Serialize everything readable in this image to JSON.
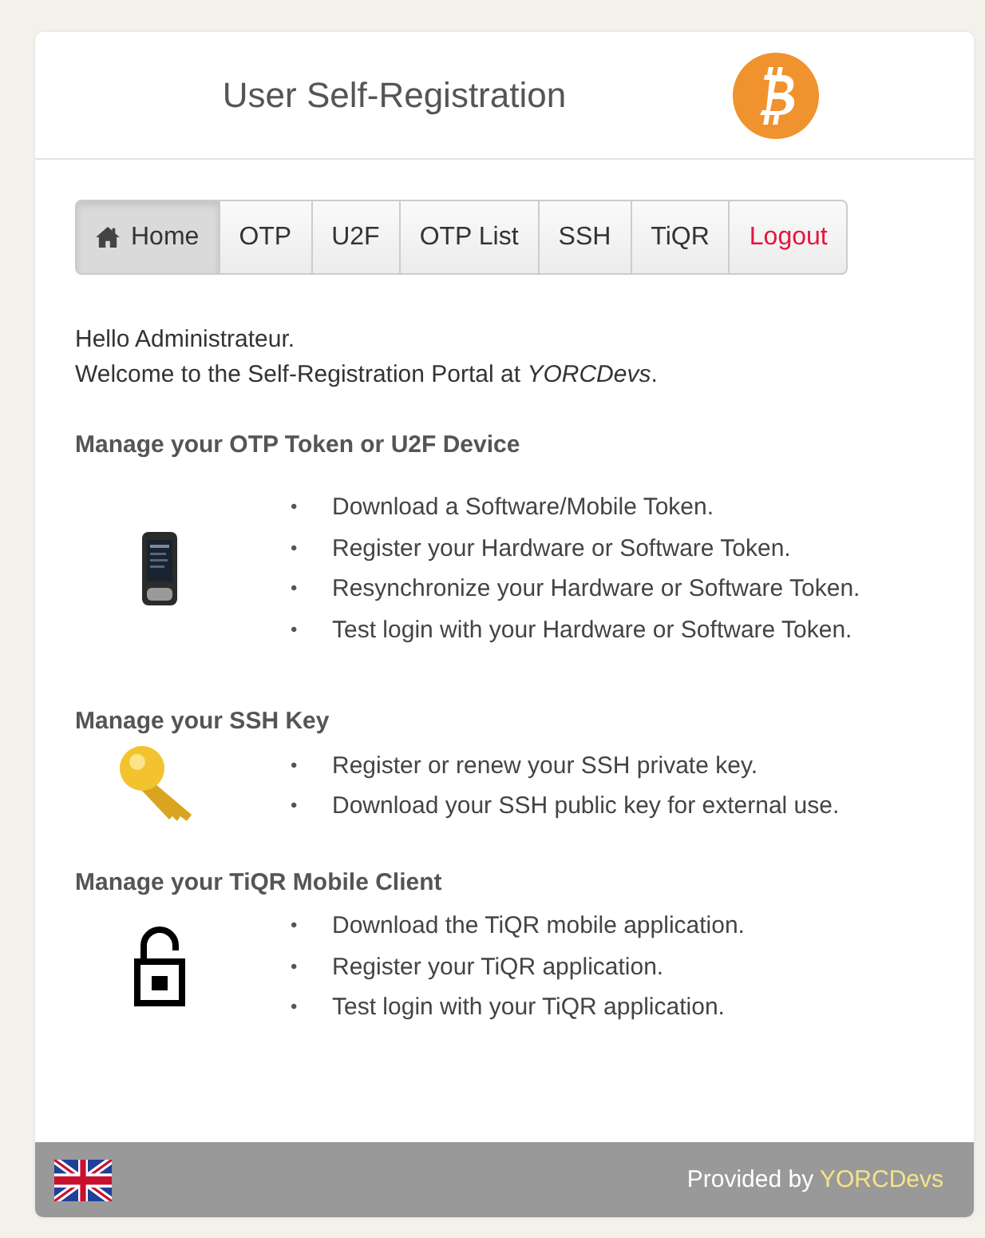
{
  "header": {
    "title": "User Self-Registration"
  },
  "nav": [
    {
      "label": "Home",
      "kind": "home",
      "selected": true
    },
    {
      "label": "OTP",
      "kind": "page",
      "selected": false
    },
    {
      "label": "U2F",
      "kind": "page",
      "selected": false
    },
    {
      "label": "OTP List",
      "kind": "page",
      "selected": false
    },
    {
      "label": "SSH",
      "kind": "page",
      "selected": false
    },
    {
      "label": "TiQR",
      "kind": "page",
      "selected": false
    },
    {
      "label": "Logout",
      "kind": "logout",
      "selected": false
    }
  ],
  "greeting": "Hello Administrateur.",
  "welcome": "Welcome to the Self-Registration Portal at *YORCDevs*.",
  "sections": [
    {
      "title": "Manage your OTP Token or U2F Device",
      "kind": "token",
      "items": [
        {
          "bullet": "•",
          "text": "Download a Software/Mobile Token."
        },
        {
          "bullet": "•",
          "text": "Register your Hardware or Software Token."
        },
        {
          "bullet": "•",
          "text": "Resynchronize your Hardware or Software Token."
        },
        {
          "bullet": "•",
          "text": "Test login with your Hardware or Software Token."
        }
      ]
    },
    {
      "title": "Manage your SSH Key",
      "kind": "key",
      "items": [
        {
          "bullet": "•",
          "text": "Register or renew your SSH private key."
        },
        {
          "bullet": "•",
          "text": "Download your SSH public key for external use."
        }
      ]
    },
    {
      "title": "Manage your TiQR Mobile Client",
      "kind": "mobile",
      "items": [
        {
          "bullet": "•",
          "text": "Download the TiQR mobile application."
        },
        {
          "bullet": "•",
          "text": "Register your TiQR application."
        },
        {
          "bullet": "•",
          "text": "Test login with your TiQR application."
        }
      ]
    }
  ],
  "footer": {
    "text": "Provided by",
    "link": "YORCDevs"
  }
}
